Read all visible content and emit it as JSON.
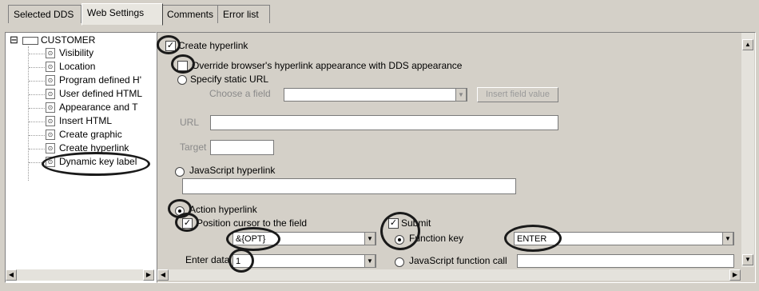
{
  "tabs": [
    {
      "label": "Selected DDS"
    },
    {
      "label": "Web Settings"
    },
    {
      "label": "Comments"
    },
    {
      "label": "Error list"
    }
  ],
  "tree": {
    "root_label": "CUSTOMER",
    "expander": "⊟",
    "items": [
      {
        "label": "Visibility"
      },
      {
        "label": "Location"
      },
      {
        "label": "Program defined H'"
      },
      {
        "label": "User defined HTML"
      },
      {
        "label": "Appearance and T"
      },
      {
        "label": "Insert HTML"
      },
      {
        "label": "Create graphic"
      },
      {
        "label": "Create hyperlink"
      },
      {
        "label": "Dynamic key label"
      }
    ]
  },
  "form": {
    "create_hyperlink": {
      "label": "Create hyperlink",
      "checked": true,
      "mark": "✓"
    },
    "override": {
      "label": "Override browser's hyperlink appearance with DDS appearance",
      "checked": false
    },
    "static_url": {
      "label": "Specify static URL"
    },
    "choose_field": {
      "label": "Choose a field",
      "value": ""
    },
    "insert_field_value": {
      "label": "Insert field value"
    },
    "url": {
      "label": "URL",
      "value": ""
    },
    "target": {
      "label": "Target",
      "value": ""
    },
    "js_hyperlink": {
      "label": "JavaScript hyperlink",
      "value": ""
    },
    "action_hyperlink": {
      "label": "Action hyperlink",
      "selected": true
    },
    "position_cursor": {
      "label": "Position cursor to the field",
      "checked": true,
      "mark": "✓",
      "value": "&{OPT}"
    },
    "submit": {
      "label": "Submit",
      "checked": true,
      "mark": "✓"
    },
    "function_key": {
      "label": "Function key",
      "selected": true,
      "value": "ENTER"
    },
    "enter_data": {
      "label": "Enter data",
      "value": "1"
    },
    "js_function_call": {
      "label": "JavaScript function call",
      "selected": false,
      "value": ""
    }
  },
  "icons": {
    "dropdown": "▼",
    "scroll_up": "▲",
    "scroll_down": "▼",
    "scroll_left": "◀",
    "scroll_right": "▶",
    "node": "⊙"
  }
}
